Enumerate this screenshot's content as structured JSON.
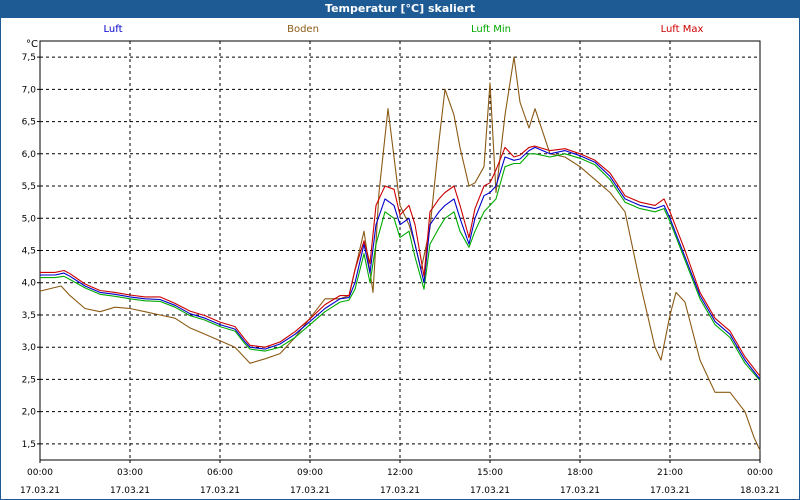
{
  "title": "Temperatur [°C] skaliert",
  "unit": "°C",
  "colors": {
    "header_bg": "#1e5a94",
    "luft": "#0000cc",
    "boden": "#8b5a14",
    "luft_min": "#00aa00",
    "luft_max": "#cc0000",
    "grid": "#000000"
  },
  "chart_data": {
    "type": "line",
    "title": "Temperatur [°C] skaliert",
    "ylabel": "°C",
    "ylim": [
      1.25,
      7.75
    ],
    "xlim": [
      0,
      24
    ],
    "yticks": [
      1.5,
      2.0,
      2.5,
      3.0,
      3.5,
      4.0,
      4.5,
      5.0,
      5.5,
      6.0,
      6.5,
      7.0,
      7.5
    ],
    "ytick_labels": [
      "1,5",
      "2,0",
      "2,5",
      "3,0",
      "3,5",
      "4,0",
      "4,5",
      "5,0",
      "5,5",
      "6,0",
      "6,5",
      "7,0",
      "7,5"
    ],
    "xticks": [
      {
        "time": "00:00",
        "date": "17.03.21"
      },
      {
        "time": "03:00",
        "date": "17.03.21"
      },
      {
        "time": "06:00",
        "date": "17.03.21"
      },
      {
        "time": "09:00",
        "date": "17.03.21"
      },
      {
        "time": "12:00",
        "date": "17.03.21"
      },
      {
        "time": "15:00",
        "date": "17.03.21"
      },
      {
        "time": "18:00",
        "date": "17.03.21"
      },
      {
        "time": "21:00",
        "date": "17.03.21"
      },
      {
        "time": "00:00",
        "date": "18.03.21"
      }
    ],
    "grid": true,
    "legend_position": "top",
    "x_unit": "hours since 17.03.21 00:00",
    "series": [
      {
        "name": "Luft",
        "color": "#0000cc",
        "points": [
          [
            0,
            4.12
          ],
          [
            0.5,
            4.12
          ],
          [
            0.8,
            4.15
          ],
          [
            1,
            4.1
          ],
          [
            1.5,
            3.95
          ],
          [
            2,
            3.85
          ],
          [
            2.5,
            3.82
          ],
          [
            3,
            3.78
          ],
          [
            3.5,
            3.75
          ],
          [
            4,
            3.74
          ],
          [
            4.5,
            3.65
          ],
          [
            5,
            3.52
          ],
          [
            5.5,
            3.45
          ],
          [
            6,
            3.35
          ],
          [
            6.5,
            3.28
          ],
          [
            6.8,
            3.1
          ],
          [
            7,
            3.0
          ],
          [
            7.5,
            2.97
          ],
          [
            8,
            3.05
          ],
          [
            8.5,
            3.2
          ],
          [
            9,
            3.4
          ],
          [
            9.5,
            3.6
          ],
          [
            10,
            3.75
          ],
          [
            10.3,
            3.77
          ],
          [
            10.5,
            4.0
          ],
          [
            10.8,
            4.6
          ],
          [
            11,
            4.15
          ],
          [
            11.2,
            4.9
          ],
          [
            11.5,
            5.3
          ],
          [
            11.8,
            5.2
          ],
          [
            12,
            4.9
          ],
          [
            12.3,
            5.0
          ],
          [
            12.5,
            4.6
          ],
          [
            12.8,
            4.0
          ],
          [
            13,
            4.9
          ],
          [
            13.3,
            5.1
          ],
          [
            13.5,
            5.2
          ],
          [
            13.8,
            5.3
          ],
          [
            14,
            5.0
          ],
          [
            14.3,
            4.6
          ],
          [
            14.5,
            5.0
          ],
          [
            14.8,
            5.35
          ],
          [
            15,
            5.4
          ],
          [
            15.2,
            5.5
          ],
          [
            15.5,
            5.95
          ],
          [
            15.8,
            5.9
          ],
          [
            16,
            5.92
          ],
          [
            16.3,
            6.05
          ],
          [
            16.5,
            6.1
          ],
          [
            17,
            6.0
          ],
          [
            17.5,
            6.05
          ],
          [
            18,
            5.97
          ],
          [
            18.5,
            5.87
          ],
          [
            19,
            5.65
          ],
          [
            19.5,
            5.3
          ],
          [
            20,
            5.2
          ],
          [
            20.5,
            5.15
          ],
          [
            20.8,
            5.2
          ],
          [
            21,
            5.0
          ],
          [
            21.5,
            4.4
          ],
          [
            22,
            3.8
          ],
          [
            22.5,
            3.4
          ],
          [
            23,
            3.2
          ],
          [
            23.5,
            2.8
          ],
          [
            24,
            2.5
          ]
        ]
      },
      {
        "name": "Boden",
        "color": "#8b5a14",
        "points": [
          [
            0,
            3.87
          ],
          [
            0.7,
            3.95
          ],
          [
            1,
            3.8
          ],
          [
            1.5,
            3.6
          ],
          [
            2,
            3.55
          ],
          [
            2.5,
            3.62
          ],
          [
            3,
            3.6
          ],
          [
            3.5,
            3.55
          ],
          [
            4,
            3.5
          ],
          [
            4.5,
            3.45
          ],
          [
            5,
            3.3
          ],
          [
            5.5,
            3.2
          ],
          [
            6,
            3.1
          ],
          [
            6.5,
            3.0
          ],
          [
            6.8,
            2.85
          ],
          [
            7,
            2.75
          ],
          [
            7.5,
            2.82
          ],
          [
            8,
            2.9
          ],
          [
            8.5,
            3.15
          ],
          [
            9,
            3.45
          ],
          [
            9.5,
            3.75
          ],
          [
            10,
            3.75
          ],
          [
            10.3,
            3.8
          ],
          [
            10.5,
            4.2
          ],
          [
            10.8,
            4.8
          ],
          [
            11.1,
            3.85
          ],
          [
            11.3,
            5.4
          ],
          [
            11.6,
            6.7
          ],
          [
            12,
            5.2
          ],
          [
            12.3,
            4.9
          ],
          [
            12.5,
            4.6
          ],
          [
            12.7,
            4.2
          ],
          [
            13,
            4.85
          ],
          [
            13.3,
            6.2
          ],
          [
            13.5,
            7.0
          ],
          [
            13.8,
            6.6
          ],
          [
            14,
            6.1
          ],
          [
            14.3,
            5.5
          ],
          [
            14.5,
            5.55
          ],
          [
            14.8,
            5.8
          ],
          [
            15,
            7.1
          ],
          [
            15.2,
            5.4
          ],
          [
            15.5,
            6.6
          ],
          [
            15.8,
            7.5
          ],
          [
            16,
            6.8
          ],
          [
            16.3,
            6.4
          ],
          [
            16.5,
            6.7
          ],
          [
            17,
            6.0
          ],
          [
            17.5,
            5.95
          ],
          [
            18,
            5.8
          ],
          [
            18.5,
            5.6
          ],
          [
            19,
            5.4
          ],
          [
            19.5,
            5.1
          ],
          [
            20,
            4.0
          ],
          [
            20.5,
            3.0
          ],
          [
            20.7,
            2.8
          ],
          [
            21,
            3.5
          ],
          [
            21.2,
            3.85
          ],
          [
            21.5,
            3.7
          ],
          [
            22,
            2.8
          ],
          [
            22.5,
            2.3
          ],
          [
            23,
            2.3
          ],
          [
            23.5,
            2.0
          ],
          [
            23.8,
            1.6
          ],
          [
            24,
            1.4
          ]
        ]
      },
      {
        "name": "Luft Min",
        "color": "#00aa00",
        "points": [
          [
            0,
            4.08
          ],
          [
            0.5,
            4.08
          ],
          [
            0.8,
            4.1
          ],
          [
            1,
            4.05
          ],
          [
            1.5,
            3.92
          ],
          [
            2,
            3.82
          ],
          [
            2.5,
            3.79
          ],
          [
            3,
            3.75
          ],
          [
            3.5,
            3.72
          ],
          [
            4,
            3.71
          ],
          [
            4.5,
            3.62
          ],
          [
            5,
            3.49
          ],
          [
            5.5,
            3.42
          ],
          [
            6,
            3.32
          ],
          [
            6.5,
            3.25
          ],
          [
            6.8,
            3.07
          ],
          [
            7,
            2.97
          ],
          [
            7.5,
            2.94
          ],
          [
            8,
            3.0
          ],
          [
            8.5,
            3.15
          ],
          [
            9,
            3.35
          ],
          [
            9.5,
            3.55
          ],
          [
            10,
            3.7
          ],
          [
            10.3,
            3.73
          ],
          [
            10.5,
            3.9
          ],
          [
            10.8,
            4.45
          ],
          [
            11,
            4.0
          ],
          [
            11.2,
            4.6
          ],
          [
            11.5,
            5.1
          ],
          [
            11.8,
            5.0
          ],
          [
            12,
            4.7
          ],
          [
            12.3,
            4.8
          ],
          [
            12.5,
            4.4
          ],
          [
            12.8,
            3.9
          ],
          [
            13,
            4.6
          ],
          [
            13.3,
            4.85
          ],
          [
            13.5,
            5.0
          ],
          [
            13.8,
            5.1
          ],
          [
            14,
            4.8
          ],
          [
            14.3,
            4.55
          ],
          [
            14.5,
            4.8
          ],
          [
            14.8,
            5.1
          ],
          [
            15,
            5.2
          ],
          [
            15.2,
            5.3
          ],
          [
            15.5,
            5.8
          ],
          [
            15.8,
            5.85
          ],
          [
            16,
            5.85
          ],
          [
            16.3,
            6.0
          ],
          [
            16.5,
            6.0
          ],
          [
            17,
            5.95
          ],
          [
            17.5,
            6.0
          ],
          [
            18,
            5.93
          ],
          [
            18.5,
            5.83
          ],
          [
            19,
            5.6
          ],
          [
            19.5,
            5.25
          ],
          [
            20,
            5.15
          ],
          [
            20.5,
            5.1
          ],
          [
            20.8,
            5.15
          ],
          [
            21,
            4.95
          ],
          [
            21.5,
            4.35
          ],
          [
            22,
            3.75
          ],
          [
            22.5,
            3.35
          ],
          [
            23,
            3.15
          ],
          [
            23.5,
            2.75
          ],
          [
            24,
            2.48
          ]
        ]
      },
      {
        "name": "Luft Max",
        "color": "#cc0000",
        "points": [
          [
            0,
            4.16
          ],
          [
            0.5,
            4.16
          ],
          [
            0.8,
            4.19
          ],
          [
            1,
            4.14
          ],
          [
            1.5,
            3.98
          ],
          [
            2,
            3.88
          ],
          [
            2.5,
            3.85
          ],
          [
            3,
            3.81
          ],
          [
            3.5,
            3.78
          ],
          [
            4,
            3.78
          ],
          [
            4.5,
            3.68
          ],
          [
            5,
            3.56
          ],
          [
            5.5,
            3.49
          ],
          [
            6,
            3.39
          ],
          [
            6.5,
            3.32
          ],
          [
            6.8,
            3.14
          ],
          [
            7,
            3.03
          ],
          [
            7.5,
            3.0
          ],
          [
            8,
            3.08
          ],
          [
            8.5,
            3.24
          ],
          [
            9,
            3.44
          ],
          [
            9.5,
            3.66
          ],
          [
            10,
            3.8
          ],
          [
            10.3,
            3.8
          ],
          [
            10.5,
            4.2
          ],
          [
            10.8,
            4.65
          ],
          [
            11,
            4.3
          ],
          [
            11.2,
            5.2
          ],
          [
            11.5,
            5.5
          ],
          [
            11.8,
            5.45
          ],
          [
            12,
            5.05
          ],
          [
            12.3,
            5.2
          ],
          [
            12.5,
            4.9
          ],
          [
            12.8,
            4.1
          ],
          [
            13,
            5.1
          ],
          [
            13.3,
            5.3
          ],
          [
            13.5,
            5.4
          ],
          [
            13.8,
            5.5
          ],
          [
            14,
            5.2
          ],
          [
            14.3,
            4.7
          ],
          [
            14.5,
            5.15
          ],
          [
            14.8,
            5.5
          ],
          [
            15,
            5.55
          ],
          [
            15.2,
            5.75
          ],
          [
            15.5,
            6.1
          ],
          [
            15.8,
            5.95
          ],
          [
            16,
            5.98
          ],
          [
            16.3,
            6.1
          ],
          [
            16.5,
            6.12
          ],
          [
            17,
            6.05
          ],
          [
            17.5,
            6.08
          ],
          [
            18,
            6.0
          ],
          [
            18.5,
            5.9
          ],
          [
            19,
            5.7
          ],
          [
            19.5,
            5.35
          ],
          [
            20,
            5.25
          ],
          [
            20.5,
            5.2
          ],
          [
            20.8,
            5.3
          ],
          [
            21,
            5.1
          ],
          [
            21.5,
            4.5
          ],
          [
            22,
            3.85
          ],
          [
            22.5,
            3.45
          ],
          [
            23,
            3.25
          ],
          [
            23.5,
            2.85
          ],
          [
            24,
            2.55
          ]
        ]
      }
    ]
  }
}
